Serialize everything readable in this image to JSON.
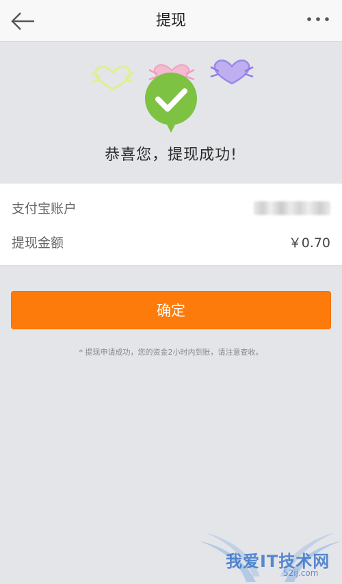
{
  "header": {
    "title": "提现",
    "back_icon": "arrow-left-icon",
    "more_icon": "more-dots-icon"
  },
  "success": {
    "icon": "check-badge-icon",
    "message": "恭喜您，提现成功!",
    "badge_color": "#7dc243"
  },
  "details": {
    "account_label": "支付宝账户",
    "amount_label": "提现金额",
    "amount_value": "￥0.70"
  },
  "actions": {
    "confirm_label": "确定",
    "confirm_color": "#fd7b0a"
  },
  "note": "* 提现申请成功，您的资金2小时内到账，请注意查收。",
  "watermark": {
    "text": "我爱IT技术网",
    "url": "52ij.com"
  }
}
